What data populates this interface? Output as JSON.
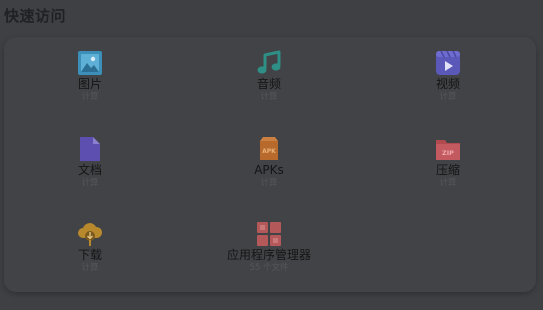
{
  "section": {
    "title": "快速访问"
  },
  "items": [
    {
      "label": "图片",
      "sub": "计算",
      "icon": "image-icon",
      "color": "#3b8fb8"
    },
    {
      "label": "音频",
      "sub": "计算",
      "icon": "music-note-icon",
      "color": "#2e8f86"
    },
    {
      "label": "视频",
      "sub": "计算",
      "icon": "video-icon",
      "color": "#5a58b8"
    },
    {
      "label": "文档",
      "sub": "计算",
      "icon": "document-icon",
      "color": "#5d4fb0"
    },
    {
      "label": "APKs",
      "sub": "计算",
      "icon": "apk-icon",
      "color": "#b86a2c"
    },
    {
      "label": "压缩",
      "sub": "计算",
      "icon": "zip-folder-icon",
      "color": "#b14a4f"
    },
    {
      "label": "下载",
      "sub": "计算",
      "icon": "cloud-download-icon",
      "color": "#b8892c"
    },
    {
      "label": "应用程序管理器",
      "sub": "55 个文件",
      "icon": "app-manager-icon",
      "color": "#b4585a"
    }
  ]
}
